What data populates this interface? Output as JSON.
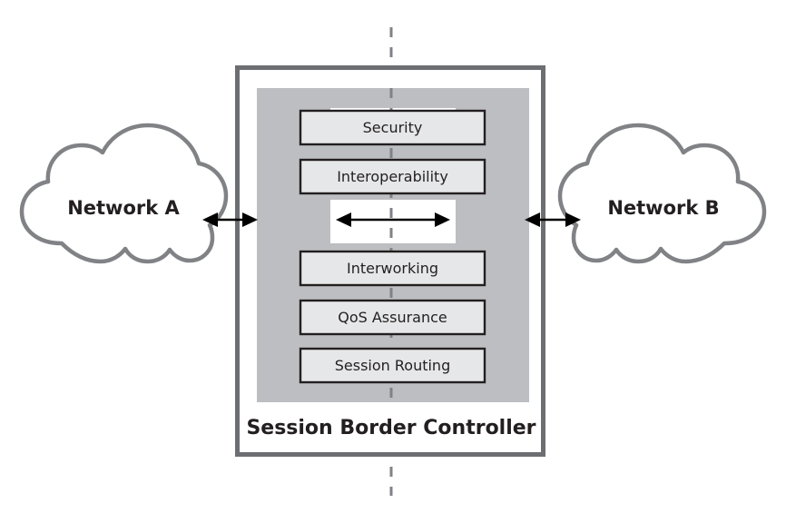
{
  "diagram": {
    "title": "Session Border Controller",
    "type": "network-architecture-diagram"
  },
  "networks": [
    {
      "id": "network-a",
      "label": "Network A",
      "side": "left"
    },
    {
      "id": "network-b",
      "label": "Network B",
      "side": "right"
    }
  ],
  "sbc": {
    "title": "Session Border Controller",
    "upper_functions": [
      {
        "id": "security",
        "label": "Security"
      },
      {
        "id": "interoperability",
        "label": "Interoperability"
      }
    ],
    "lower_functions": [
      {
        "id": "interworking",
        "label": "Interworking"
      },
      {
        "id": "qos-assurance",
        "label": "QoS Assurance"
      },
      {
        "id": "session-routing",
        "label": "Session Routing"
      }
    ]
  },
  "connectors": {
    "left_arrow": {
      "id": "network-a-to-sbc",
      "style": "double-headed"
    },
    "right_arrow": {
      "id": "sbc-to-network-b",
      "style": "double-headed"
    },
    "center_arrow": {
      "id": "internal-media-path",
      "style": "double-headed"
    },
    "midline": {
      "id": "demarcation-line",
      "style": "dashed-vertical"
    }
  },
  "colors": {
    "outline": "#6d6e71",
    "gray_block": "#bcbec1",
    "box_fill": "#e6e7e8",
    "box_stroke": "#231f20",
    "text": "#231f20",
    "background": "#ffffff",
    "arrow": "#000000",
    "dash": "#808285"
  }
}
